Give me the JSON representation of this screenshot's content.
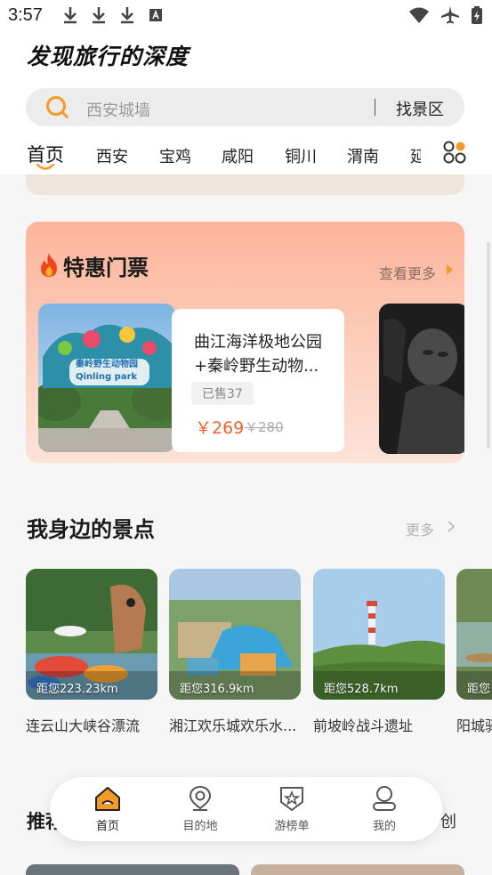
{
  "status_bar": {
    "time": "3:57"
  },
  "header": {
    "logo_text": "发现旅行的深度",
    "search": {
      "placeholder": "西安城墙",
      "action_label": "找景区"
    },
    "city_tabs": [
      "首页",
      "西安",
      "宝鸡",
      "咸阳",
      "铜川",
      "渭南",
      "延"
    ],
    "active_tab": "首页"
  },
  "deals": {
    "title": "特惠门票",
    "more_label": "查看更多",
    "ticket": {
      "name": "曲江海洋极地公园+秦岭野生动物...",
      "sold": "已售37",
      "price": "￥269",
      "original_price": "￥280",
      "image_sign_text": "秦岭野生动物园 Qinling park"
    }
  },
  "nearby": {
    "title": "我身边的景点",
    "more_label": "更多",
    "spots": [
      {
        "distance": "距您223.23km",
        "name": "连云山大峡谷漂流"
      },
      {
        "distance": "距您316.9km",
        "name": "湘江欢乐城欢乐水..."
      },
      {
        "distance": "距您528.7km",
        "name": "前坡岭战斗遗址"
      },
      {
        "distance": "距您",
        "name": "阳城驿"
      }
    ]
  },
  "recommend": {
    "title": "推荐",
    "side_text": "创"
  },
  "bottom_nav": {
    "items": [
      {
        "label": "首页",
        "icon": "home-icon"
      },
      {
        "label": "目的地",
        "icon": "location-pin-icon"
      },
      {
        "label": "游榜单",
        "icon": "ranking-badge-icon"
      },
      {
        "label": "我的",
        "icon": "profile-icon"
      }
    ],
    "active": "首页"
  },
  "colors": {
    "accent": "#f0612b",
    "brand_orange": "#f39a2b",
    "deals_gradient_top": "#fdb49a"
  }
}
